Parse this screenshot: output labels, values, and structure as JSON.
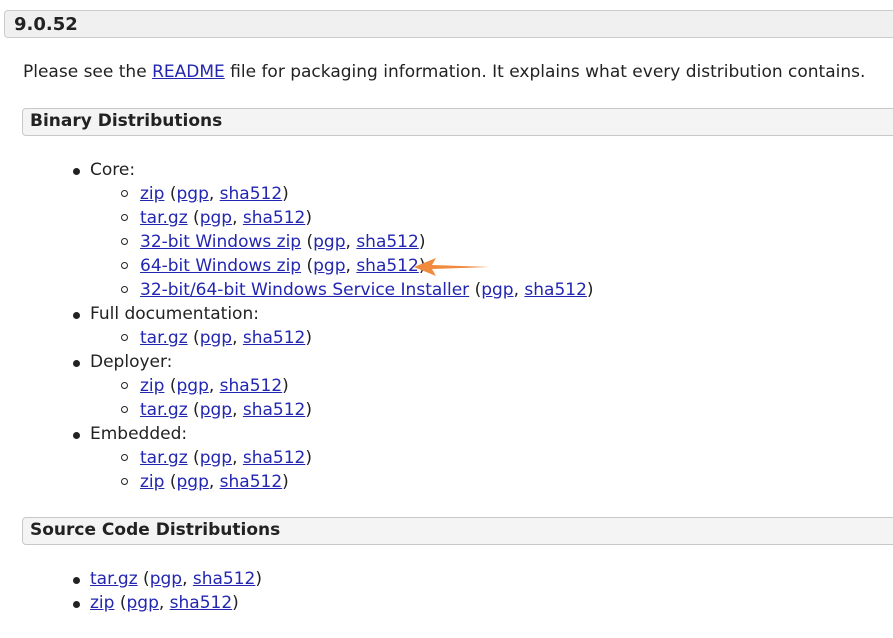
{
  "version": "9.0.52",
  "intro": {
    "prefix": "Please see the ",
    "link": "README",
    "suffix": " file for packaging information. It explains what every distribution contains."
  },
  "binary": {
    "title": "Binary Distributions",
    "groups": [
      {
        "label": "Core:",
        "items": [
          {
            "name": "zip",
            "pgp": "pgp",
            "sha": "sha512"
          },
          {
            "name": "tar.gz",
            "pgp": "pgp",
            "sha": "sha512"
          },
          {
            "name": "32-bit Windows zip",
            "pgp": "pgp",
            "sha": "sha512"
          },
          {
            "name": "64-bit Windows zip",
            "pgp": "pgp",
            "sha": "sha512"
          },
          {
            "name": "32-bit/64-bit Windows Service Installer",
            "pgp": "pgp",
            "sha": "sha512"
          }
        ]
      },
      {
        "label": "Full documentation:",
        "items": [
          {
            "name": "tar.gz",
            "pgp": "pgp",
            "sha": "sha512"
          }
        ]
      },
      {
        "label": "Deployer:",
        "items": [
          {
            "name": "zip",
            "pgp": "pgp",
            "sha": "sha512"
          },
          {
            "name": "tar.gz",
            "pgp": "pgp",
            "sha": "sha512"
          }
        ]
      },
      {
        "label": "Embedded:",
        "items": [
          {
            "name": "tar.gz",
            "pgp": "pgp",
            "sha": "sha512"
          },
          {
            "name": "zip",
            "pgp": "pgp",
            "sha": "sha512"
          }
        ]
      }
    ]
  },
  "source": {
    "title": "Source Code Distributions",
    "items": [
      {
        "name": "tar.gz",
        "pgp": "pgp",
        "sha": "sha512"
      },
      {
        "name": "zip",
        "pgp": "pgp",
        "sha": "sha512"
      }
    ]
  },
  "annotation": {
    "arrow_color": "#f08a3c",
    "icon": "arrow-left-icon"
  },
  "punct": {
    "open": " (",
    "comma": ", ",
    "close": ")"
  }
}
